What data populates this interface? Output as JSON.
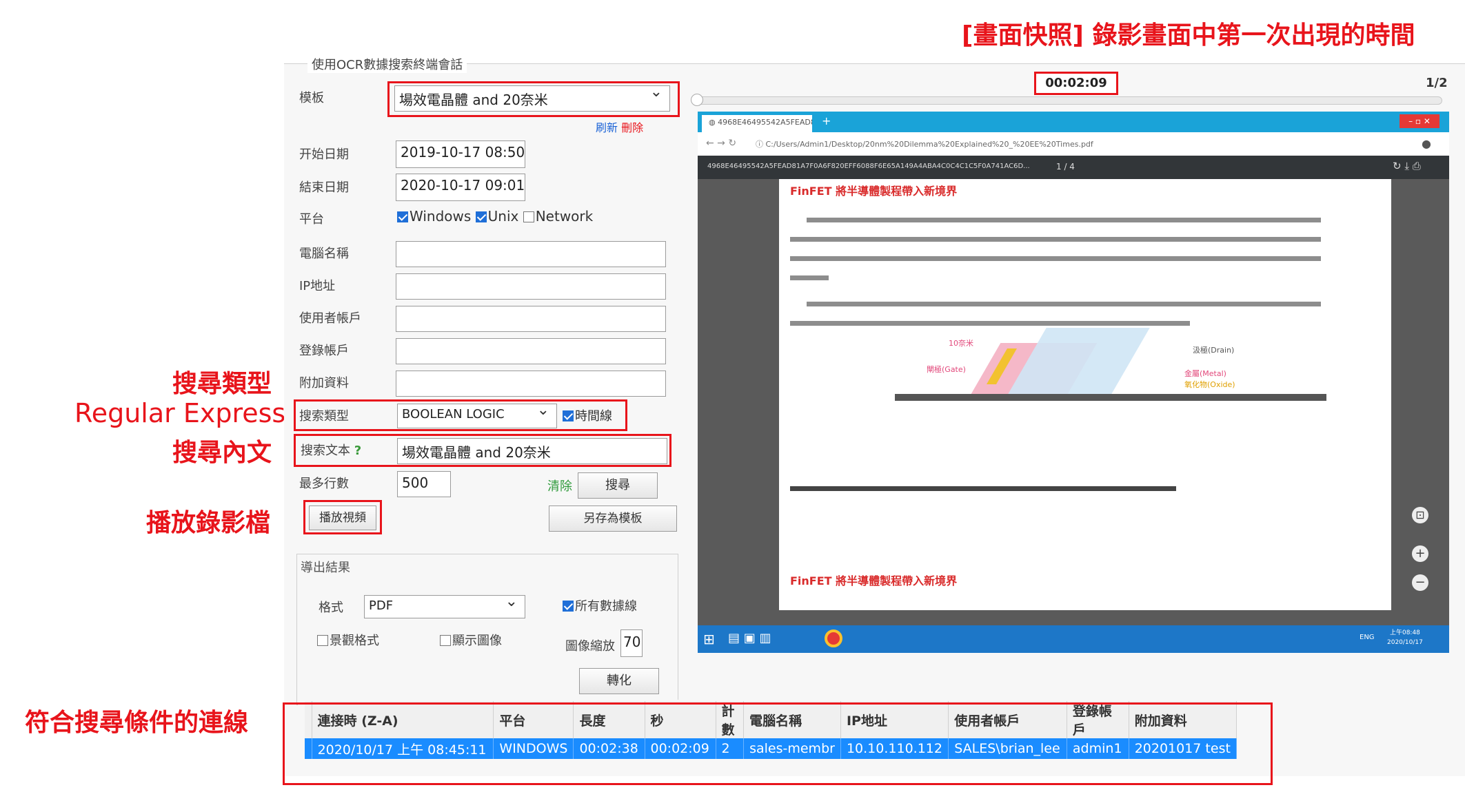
{
  "annotations": {
    "top_right": "[畫面快照] 錄影畫面中第一次出現的時間",
    "search_type": "搜尋類型",
    "regex": "Regular Express",
    "search_text": "搜尋內文",
    "play_video": "播放錄影檔",
    "matching_sessions": "符合搜尋條件的連線"
  },
  "panel": {
    "title": "使用OCR數據搜索終端會話",
    "template_label": "模板",
    "template_value": "場效電晶體 and 20奈米",
    "refresh": "刷新",
    "delete": "刪除",
    "start_date_label": "开始日期",
    "start_date": "2019-10-17 08:50",
    "end_date_label": "結束日期",
    "end_date": "2020-10-17 09:01",
    "platform_label": "平台",
    "platforms": [
      {
        "label": "Windows",
        "checked": true
      },
      {
        "label": "Unix",
        "checked": true
      },
      {
        "label": "Network",
        "checked": false
      }
    ],
    "computer_name_label": "電腦名稱",
    "ip_label": "IP地址",
    "user_account_label": "使用者帳戶",
    "login_account_label": "登錄帳戶",
    "extra_label": "附加資料",
    "search_type_label": "搜索類型",
    "search_type_value": "BOOLEAN LOGIC",
    "timeline_label": "時間線",
    "search_text_label": "搜索文本",
    "search_text_help": "?",
    "search_text_value": "場效電晶體 and 20奈米",
    "max_rows_label": "最多行數",
    "max_rows_value": "500",
    "clear": "清除",
    "search_btn": "搜尋",
    "play_btn": "播放視頻",
    "save_template_btn": "另存為模板"
  },
  "export": {
    "title": "導出結果",
    "format_label": "格式",
    "format_value": "PDF",
    "all_data_label": "所有數據線",
    "landscape_label": "景觀格式",
    "show_image_label": "顯示圖像",
    "zoom_label": "圖像縮放",
    "zoom_value": "70",
    "convert_btn": "轉化"
  },
  "player": {
    "time": "00:02:09",
    "page": "1/2",
    "progress": 0.0,
    "browser_tab": "4968E46495542A5FEAD81...",
    "address": "C:/Users/Admin1/Desktop/20nm%20Dilemma%20Explained%20_%20EE%20Times.pdf",
    "pdf_toolbar": "4968E46495542A5FEAD81A7F0A6F820EFF6088F6E65A149A4ABA4C0C4C1C5F0A741AC6D...",
    "pdf_page": "1 / 4",
    "pdf_heading": "FinFET 將半導體製程帶入新境界",
    "pdf_heading2": "FinFET 將半導體製程帶入新境界",
    "labels": {
      "nm": "10奈米",
      "drain": "汲極(Drain)",
      "gate": "閘極(Gate)",
      "metal": "金屬(Metal)",
      "oxide": "氧化物(Oxide)"
    },
    "tray_lang": "ENG",
    "tray_time": "上午08:48",
    "tray_date": "2020/10/17"
  },
  "results": {
    "columns": [
      "連接時 (Z-A)",
      "平台",
      "長度",
      "秒",
      "計數",
      "電腦名稱",
      "IP地址",
      "使用者帳戶",
      "登錄帳戶",
      "附加資料"
    ],
    "rows": [
      [
        "2020/10/17 上午 08:45:11",
        "WINDOWS",
        "00:02:38",
        "00:02:09",
        "2",
        "sales-membr",
        "10.10.110.112",
        "SALES\\brian_lee",
        "admin1",
        "20201017 test"
      ]
    ]
  }
}
